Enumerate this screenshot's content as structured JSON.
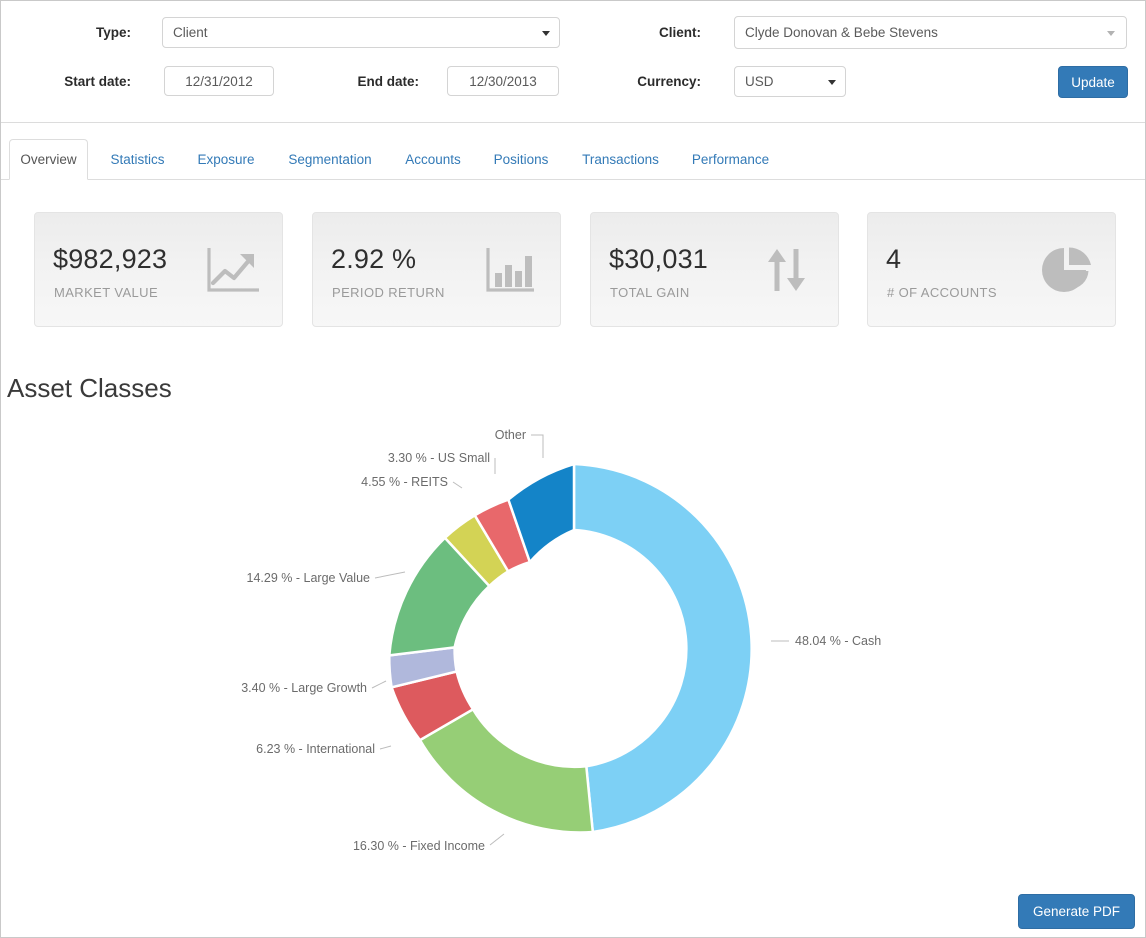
{
  "filters": {
    "type": {
      "label": "Type:",
      "value": "Client"
    },
    "client": {
      "label": "Client:",
      "value": "Clyde Donovan & Bebe Stevens"
    },
    "start_date": {
      "label": "Start date:",
      "value": "12/31/2012"
    },
    "end_date": {
      "label": "End date:",
      "value": "12/30/2013"
    },
    "currency": {
      "label": "Currency:",
      "value": "USD"
    },
    "update_button": "Update"
  },
  "tabs": [
    {
      "label": "Overview",
      "active": true
    },
    {
      "label": "Statistics",
      "active": false
    },
    {
      "label": "Exposure",
      "active": false
    },
    {
      "label": "Segmentation",
      "active": false
    },
    {
      "label": "Accounts",
      "active": false
    },
    {
      "label": "Positions",
      "active": false
    },
    {
      "label": "Transactions",
      "active": false
    },
    {
      "label": "Performance",
      "active": false
    }
  ],
  "kpis": [
    {
      "value": "$982,923",
      "label": "MARKET VALUE",
      "icon": "line-chart-icon"
    },
    {
      "value": "2.92 %",
      "label": "PERIOD RETURN",
      "icon": "bar-chart-icon"
    },
    {
      "value": "$30,031",
      "label": "TOTAL GAIN",
      "icon": "up-down-arrows-icon"
    },
    {
      "value": "4",
      "label": "# OF ACCOUNTS",
      "icon": "pie-chart-icon"
    }
  ],
  "section": {
    "title": "Asset Classes"
  },
  "footer": {
    "generate_pdf": "Generate PDF"
  },
  "colors": {
    "accent": "#337ab7",
    "tab_link": "#337ab7",
    "kpi_icon": "#bdbdbd"
  },
  "chart_data": {
    "type": "pie",
    "variant": "donut",
    "title": "Asset Classes",
    "legend": "none",
    "labels_outside": true,
    "start_angle_deg": -90,
    "direction": "clockwise",
    "inner_radius_ratio": 0.6,
    "categories": [
      "Cash",
      "Fixed Income",
      "International",
      "Large Growth",
      "Large Value",
      "REITS",
      "US Small",
      "Other"
    ],
    "values": [
      48.04,
      16.3,
      6.23,
      3.4,
      14.29,
      4.55,
      3.3,
      3.89
    ],
    "unit": "%",
    "slice_colors": [
      "#7dd0f5",
      "#96ce76",
      "#dd5a5e",
      "#b0b8dc",
      "#6cbe7f",
      "#d3d355",
      "#e8686b",
      "#1484c8"
    ],
    "point_labels": [
      "48.04 % - Cash",
      "16.30 % - Fixed Income",
      "6.23 % - International",
      "3.40 % - Large Growth",
      "14.29 % - Large Value",
      "4.55 % - REITS",
      "3.30 % - US Small",
      "Other"
    ]
  }
}
